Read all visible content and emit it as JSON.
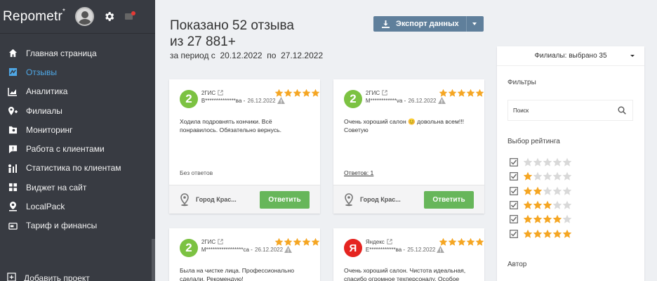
{
  "sidebar": {
    "logo": "Repometr",
    "logo_mark": "*",
    "nav": [
      {
        "label": "Главная страница",
        "icon": "home-icon",
        "active": false
      },
      {
        "label": "Отзывы",
        "icon": "reviews-icon",
        "active": true
      },
      {
        "label": "Аналитика",
        "icon": "analytics-icon",
        "active": false
      },
      {
        "label": "Филиалы",
        "icon": "branches-icon",
        "active": false
      },
      {
        "label": "Мониторинг",
        "icon": "monitoring-icon",
        "active": false
      },
      {
        "label": "Работа с клиентами",
        "icon": "clients-icon",
        "active": false
      },
      {
        "label": "Статистика по клиентам",
        "icon": "client-stats-icon",
        "active": false
      },
      {
        "label": "Виджет на сайт",
        "icon": "widget-icon",
        "active": false
      },
      {
        "label": "LocalPack",
        "icon": "localpack-icon",
        "active": false
      },
      {
        "label": "Тариф и финансы",
        "icon": "tariff-icon",
        "active": false
      }
    ],
    "add_project": "Добавить проект"
  },
  "header": {
    "title": "Показано 52 отзыва из 27 881+",
    "period_prefix": "за период с",
    "date_from": "20.12.2022",
    "period_mid": "по",
    "date_to": "27.12.2022",
    "export_label": "Экспорт данных"
  },
  "colors": {
    "sidebar_bg": "#383b42",
    "active_nav": "#4fa8e6",
    "export_btn": "#5f7f9b",
    "reply_btn": "#67b65a",
    "star": "#f5a623",
    "star_empty": "#d9d9d9",
    "gis_green": "#7cc242",
    "yandex_red": "#e52420"
  },
  "reviews": [
    {
      "source": "2ГИС",
      "source_logo": "2",
      "author": "В**************ва",
      "date": "26.12.2022",
      "rating": 5,
      "text": "Ходила подровнять кончики. Всё понравилось. Обязательно вернусь.",
      "answers": "Без ответов",
      "branch": "Город Крас...",
      "reply_label": "Ответить"
    },
    {
      "source": "2ГИС",
      "source_logo": "2",
      "author": "М************va",
      "date": "26.12.2022",
      "rating": 5,
      "text": "Очень хороший салон 😊 довольна всем!!! Советую",
      "answers": "Ответов: 1",
      "branch": "Город Крас...",
      "reply_label": "Ответить"
    },
    {
      "source": "2ГИС",
      "source_logo": "2",
      "author": "М*****************ca",
      "date": "26.12.2022",
      "rating": 5,
      "text": "Была на чистке лица. Профессионально сделали. Рекомендую!"
    },
    {
      "source": "Яндекс",
      "source_logo": "Я",
      "author": "Е************ва",
      "date": "25.12.2022",
      "rating": 5,
      "text": "Очень хороший салон. Чистота идеальная, спасибо огромное техперсоналу. Особое"
    }
  ],
  "filters": {
    "branches_selected": "Филиалы: выбрано 35",
    "title": "Фильтры",
    "search_label": "Поиск",
    "rating_title": "Выбор рейтинга",
    "ratings": [
      0,
      1,
      2,
      3,
      4,
      5
    ],
    "author_title": "Автор"
  }
}
